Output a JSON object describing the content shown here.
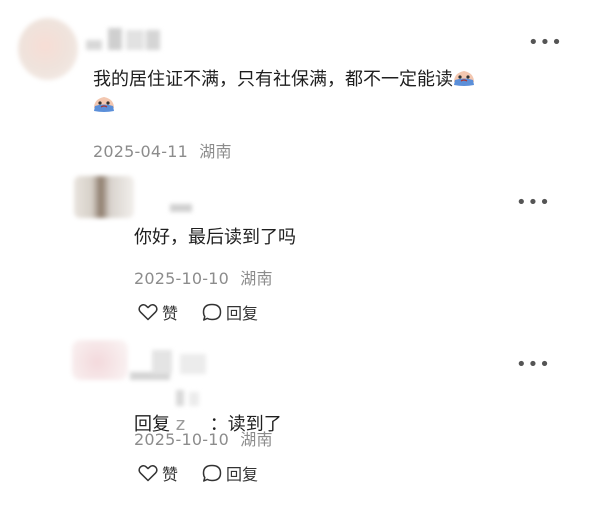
{
  "colors": {
    "text": "#1f1f1f",
    "meta": "#8c8c8c",
    "background": "#ffffff"
  },
  "comment": {
    "text": "我的居住证不满，只有社保满，都不一定能读",
    "emoji": "crying-face-emoji",
    "date": "2025-04-11",
    "location": "湖南"
  },
  "replies": [
    {
      "text": "你好，最后读到了吗",
      "date": "2025-10-10",
      "location": "湖南",
      "like_label": "赞",
      "reply_label": "回复"
    },
    {
      "reply_prefix": "回复",
      "reply_target_visible": "z",
      "reply_sep": "：",
      "text": "读到了",
      "date": "2025-10-10",
      "location": "湖南",
      "like_label": "赞",
      "reply_label": "回复"
    }
  ],
  "icons": {
    "more": "more-dots-icon",
    "like": "heart-icon",
    "reply": "comment-bubble-icon"
  }
}
